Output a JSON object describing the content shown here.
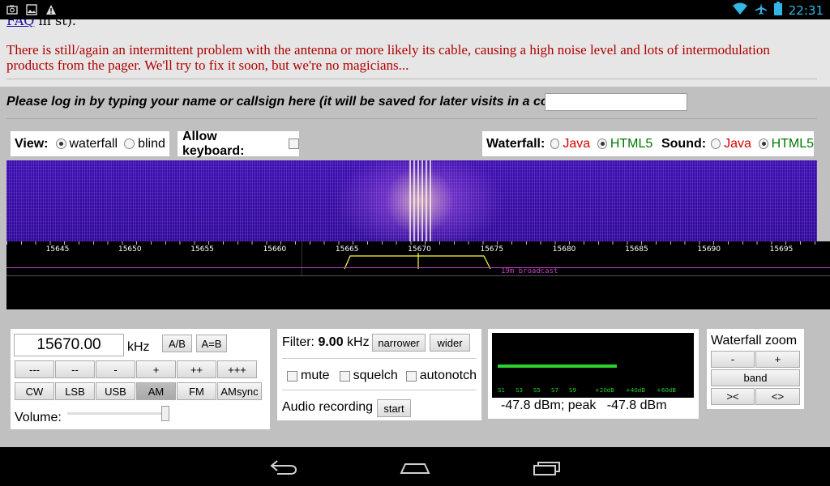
{
  "statusbar": {
    "time": "22:31",
    "left_icons": [
      "screenshot-icon",
      "image-icon",
      "warning-icon"
    ],
    "right_icons": [
      "wifi-icon",
      "airplane-icon",
      "battery-icon"
    ]
  },
  "page": {
    "faq_link": "FAQ",
    "faq_tail": " in st).",
    "notice": "There is still/again an intermittent problem with the antenna or more likely its cable, causing a high noise level and lots of intermodulation products from the pager. We'll try to fix it soon, but we're no magicians...",
    "login_prompt": "Please log in by typing your name or callsign here (it will be saved for later visits in a cookie):",
    "login_value": ""
  },
  "view": {
    "label": "View:",
    "waterfall_label": "waterfall",
    "blind_label": "blind",
    "selected": "waterfall"
  },
  "keyboard": {
    "label": "Allow keyboard:",
    "checked": false
  },
  "render": {
    "waterfall_label": "Waterfall:",
    "sound_label": "Sound:",
    "java": "Java",
    "html5": "HTML5",
    "waterfall_selected": "HTML5",
    "sound_selected": "HTML5"
  },
  "scale": {
    "ticks": [
      "15645",
      "15650",
      "15655",
      "15660",
      "15665",
      "15670",
      "15675",
      "15680",
      "15685",
      "15690",
      "15695"
    ],
    "band_label": "19m broadcast"
  },
  "tuning": {
    "frequency": "15670.00",
    "unit": "kHz",
    "ab_label": "A/B",
    "aeqb_label": "A=B",
    "step_buttons": [
      "---",
      "--",
      "-",
      "+",
      "++",
      "+++"
    ],
    "mode_buttons": [
      "CW",
      "LSB",
      "USB",
      "AM",
      "FM",
      "AMsync"
    ],
    "active_mode": "AM",
    "volume_label": "Volume:"
  },
  "filter": {
    "label": "Filter:",
    "value": "9.00",
    "unit": "kHz",
    "narrower": "narrower",
    "wider": "wider",
    "mute": "mute",
    "squelch": "squelch",
    "autonotch": "autonotch",
    "recording_label": "Audio recording",
    "start": "start"
  },
  "smeter": {
    "scale_labels": [
      "S1",
      "S3",
      "S5",
      "S7",
      "S9",
      "+20dB",
      "+40dB",
      "+60dB"
    ],
    "readout": "-47.8 dBm; peak   -47.8 dBm",
    "bar_fraction": 0.6
  },
  "zoom": {
    "title": "Waterfall zoom",
    "minus": "-",
    "plus": "+",
    "band": "band",
    "zoom_in": "><",
    "zoom_out": "<>"
  },
  "navbar": {
    "icons": [
      "back-icon",
      "home-icon",
      "recent-apps-icon"
    ]
  }
}
